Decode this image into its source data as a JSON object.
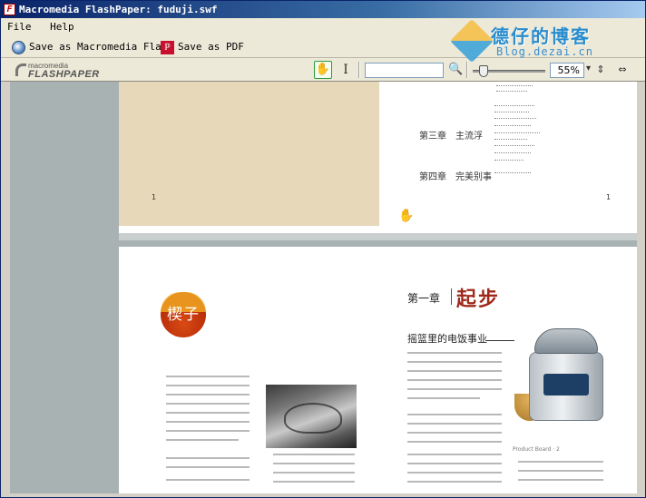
{
  "window": {
    "title": "Macromedia FlashPaper: fuduji.swf",
    "app_icon": "flashpaper-app-icon"
  },
  "menu": {
    "items": [
      "File",
      "Help"
    ]
  },
  "toolbar": {
    "save_flash_label": "Save as Macromedia Flash",
    "save_pdf_label": "Save as PDF",
    "logo_top": "macromedia",
    "logo_bottom": "FLASHPAPER",
    "find_placeholder": "",
    "zoom_value": "55%",
    "zoom_fraction": 0.1,
    "zoom_caret": "▾",
    "icons": {
      "hand": "hand-tool-icon",
      "text": "text-select-icon",
      "search": "search-icon",
      "fit_width": "fit-width-icon",
      "fit_page": "fit-page-icon"
    }
  },
  "watermark": {
    "cn": "德仔的博客",
    "en": "Blog.dezai.cn"
  },
  "page1": {
    "left_mark": "1",
    "right_mark": "1",
    "toc": [
      {
        "label": "第三章　主流浮"
      },
      {
        "label": "第四章　完美别事"
      }
    ]
  },
  "page2": {
    "badge": "楔子",
    "chapter_small": "第一章",
    "chapter_big": "起步",
    "section_title": "摇篮里的电饭事业",
    "cooker_caption": "Product Board · 2"
  },
  "colors": {
    "accent_red": "#a0281b",
    "highlight_green": "#2e9a3a",
    "page_bg": "#e6d8b9"
  }
}
